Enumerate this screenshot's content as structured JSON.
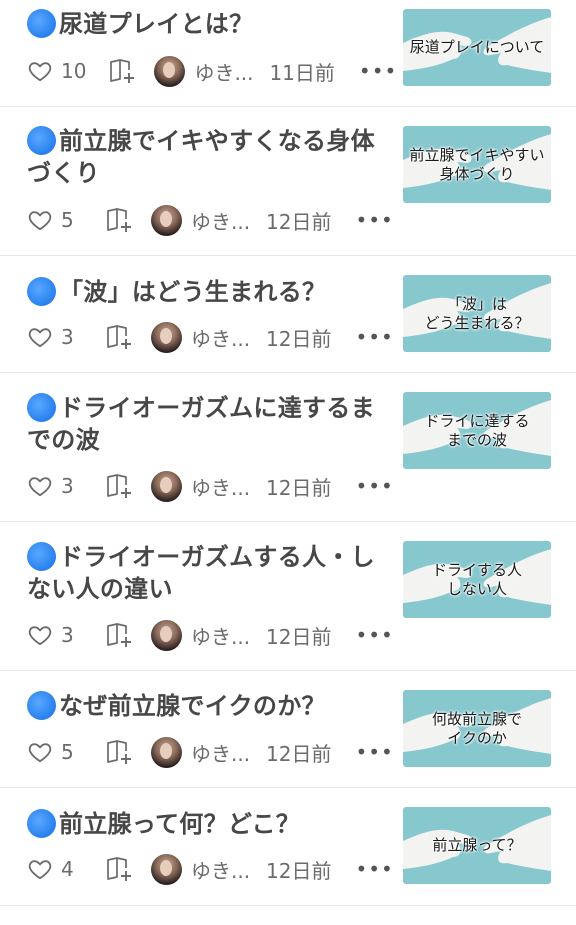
{
  "articles": [
    {
      "title": "尿道プレイとは？",
      "likes": "10",
      "author": "ゆき...",
      "date": "11日前",
      "thumbnail_text": "尿道プレイについて"
    },
    {
      "title": "前立腺でイキやすくなる身体づくり",
      "likes": "5",
      "author": "ゆき...",
      "date": "12日前",
      "thumbnail_text": "前立腺でイキやすい\n身体づくり"
    },
    {
      "title": "「波」はどう生まれる？",
      "likes": "3",
      "author": "ゆき...",
      "date": "12日前",
      "thumbnail_text": "「波」は\nどう生まれる？"
    },
    {
      "title": "ドライオーガズムに達するまでの波",
      "likes": "3",
      "author": "ゆき...",
      "date": "12日前",
      "thumbnail_text": "ドライに達する\nまでの波"
    },
    {
      "title": "ドライオーガズムする人・しない人の違い",
      "likes": "3",
      "author": "ゆき...",
      "date": "12日前",
      "thumbnail_text": "ドライする人\nしない人"
    },
    {
      "title": "なぜ前立腺でイクのか？",
      "likes": "5",
      "author": "ゆき...",
      "date": "12日前",
      "thumbnail_text": "何故前立腺で\nイクのか"
    },
    {
      "title": "前立腺って何？どこ？",
      "likes": "4",
      "author": "ゆき...",
      "date": "12日前",
      "thumbnail_text": "前立腺って？"
    }
  ],
  "icons": {
    "bullet": "blue-dot-icon",
    "like": "heart-icon",
    "save": "magazine-add-icon",
    "menu": "more-dots-icon"
  },
  "colors": {
    "accent_dot": "#2e86f0",
    "thumbnail_bg": "#87c7ce",
    "text": "#474747",
    "meta_text": "#6b6b6b"
  }
}
